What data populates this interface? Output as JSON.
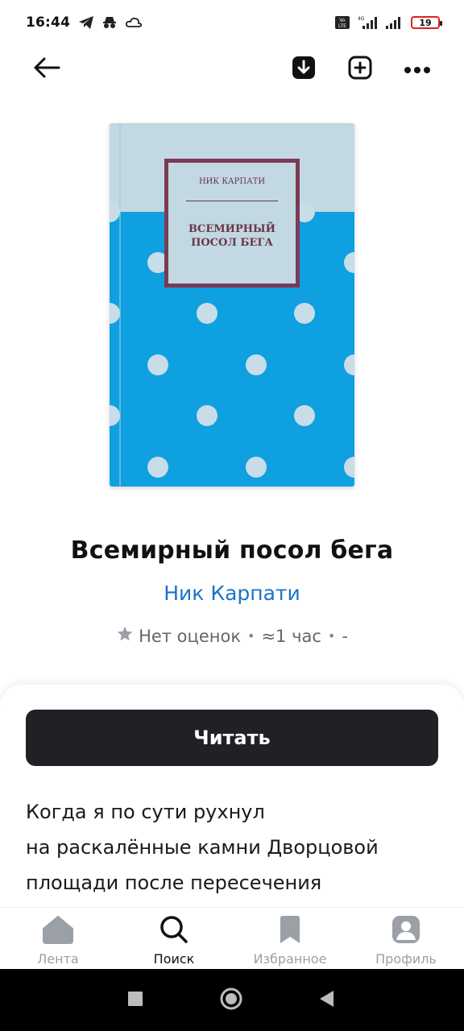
{
  "status_bar": {
    "time": "16:44",
    "battery": "19",
    "volte": "Vo LTE",
    "network": "4G"
  },
  "top_bar": {
    "back_icon": "arrow-left-icon",
    "download_icon": "download-icon",
    "add_icon": "add-square-icon",
    "more_icon": "more-horizontal-icon"
  },
  "cover": {
    "author": "НИК КАРПАТИ",
    "title_line1": "ВСЕМИРНЫЙ",
    "title_line2": "ПОСОЛ БЕГА",
    "colors": {
      "top": "#c2d8e2",
      "bottom": "#0ea0e0",
      "dots": "#c8dde8",
      "frame": "#7b3b55"
    }
  },
  "book": {
    "title": "Всемирный посол бега",
    "author": "Ник Карпати",
    "rating": "Нет оценок",
    "duration": "≈1 час",
    "extra": "-"
  },
  "actions": {
    "read_label": "Читать"
  },
  "description": {
    "line1": "Когда я по сути рухнул",
    "line2": "на раскалённые камни Дворцовой",
    "line3": "площади после пересечения"
  },
  "nav": {
    "items": [
      {
        "label": "Лента",
        "icon": "home-icon",
        "active": false
      },
      {
        "label": "Поиск",
        "icon": "search-icon",
        "active": true
      },
      {
        "label": "Избранное",
        "icon": "bookmark-icon",
        "active": false
      },
      {
        "label": "Профиль",
        "icon": "profile-icon",
        "active": false
      }
    ]
  },
  "colors": {
    "accent_link": "#1a73c8",
    "button_dark": "#202124",
    "nav_inactive": "#9aa0a6"
  }
}
